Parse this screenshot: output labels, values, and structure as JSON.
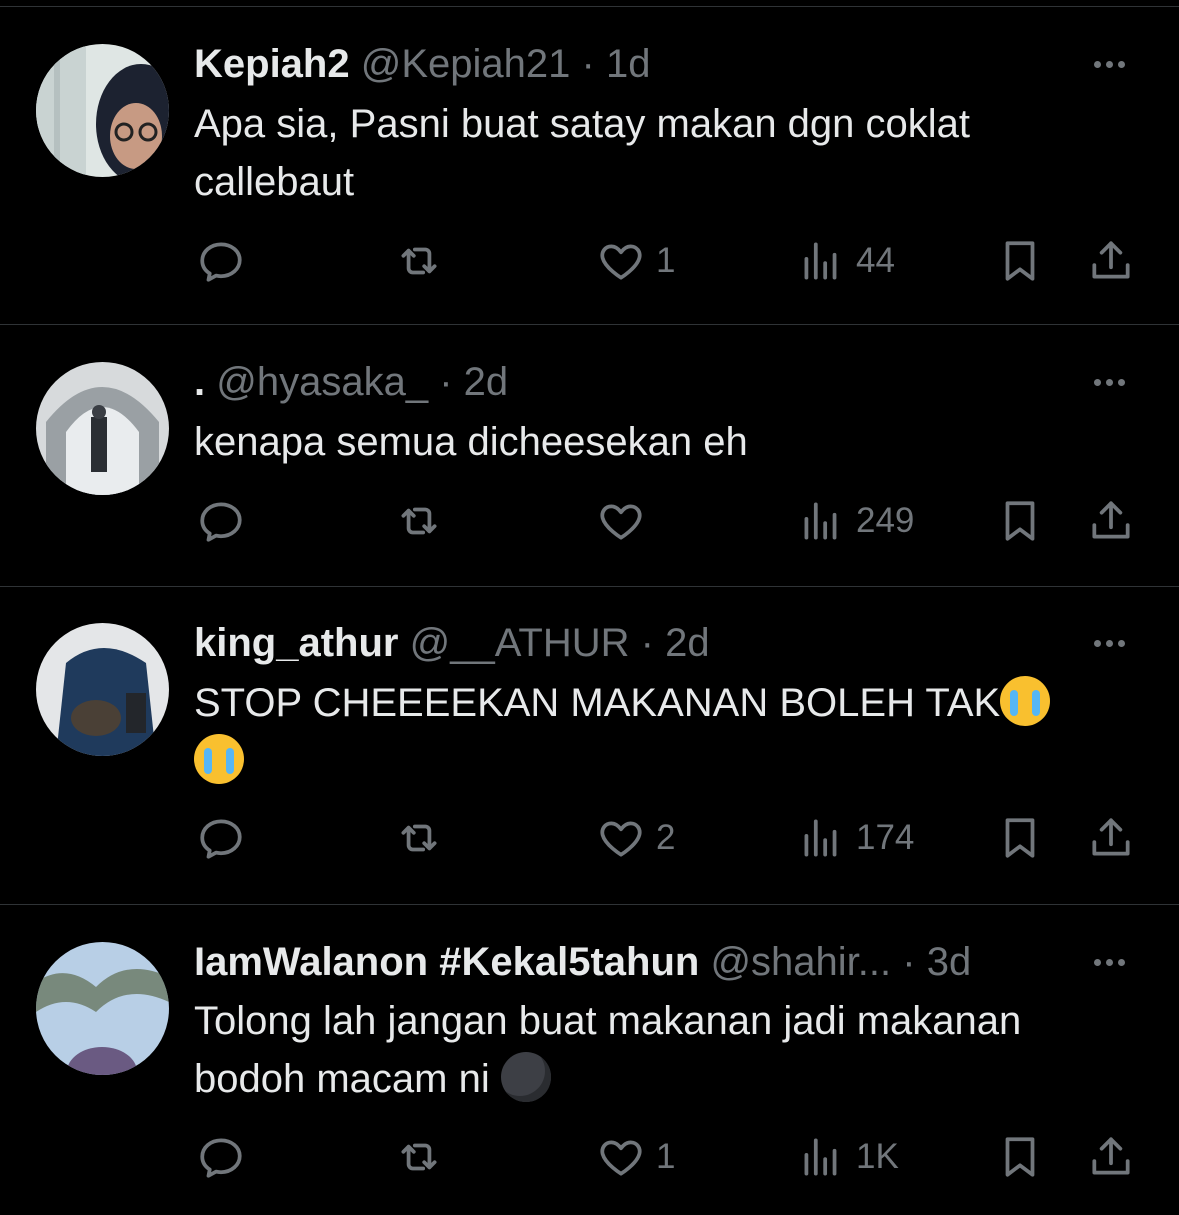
{
  "tweets": [
    {
      "name": "Kepiah2",
      "handle": "@Kepiah21",
      "separator": "·",
      "time": "1d",
      "text_lines": [
        "Apa sia, Pasni buat satay makan dgn coklat",
        "callebaut"
      ],
      "likes": "1",
      "views": "44"
    },
    {
      "name": ".",
      "handle": "@hyasaka_",
      "separator": "·",
      "time": "2d",
      "text_lines": [
        "kenapa semua dicheesekan eh"
      ],
      "likes": "",
      "views": "249"
    },
    {
      "name": "king_athur",
      "handle": "@__ATHUR",
      "separator": "·",
      "time": "2d",
      "text_lines": [
        "STOP CHEEEEKAN MAKANAN BOLEH TAK",
        ""
      ],
      "emoji": "loudly-crying-face",
      "likes": "2",
      "views": "174"
    },
    {
      "name": "IamWalanon #Kekal5tahun",
      "handle": "@shahir...",
      "separator": "·",
      "time": "3d",
      "text_lines": [
        "Tolong lah jangan buat makanan jadi makanan",
        "bodoh macam ni"
      ],
      "emoji": "new-moon-face",
      "likes": "1",
      "views": "1K"
    }
  ],
  "icons": {
    "reply": "reply-icon",
    "retweet": "retweet-icon",
    "like": "heart-icon",
    "views": "views-icon",
    "bookmark": "bookmark-icon",
    "share": "share-icon",
    "more": "more-icon"
  },
  "colors": {
    "background": "#000000",
    "text": "#e7e9ea",
    "secondary": "#71767b",
    "divider": "#2f3336"
  }
}
